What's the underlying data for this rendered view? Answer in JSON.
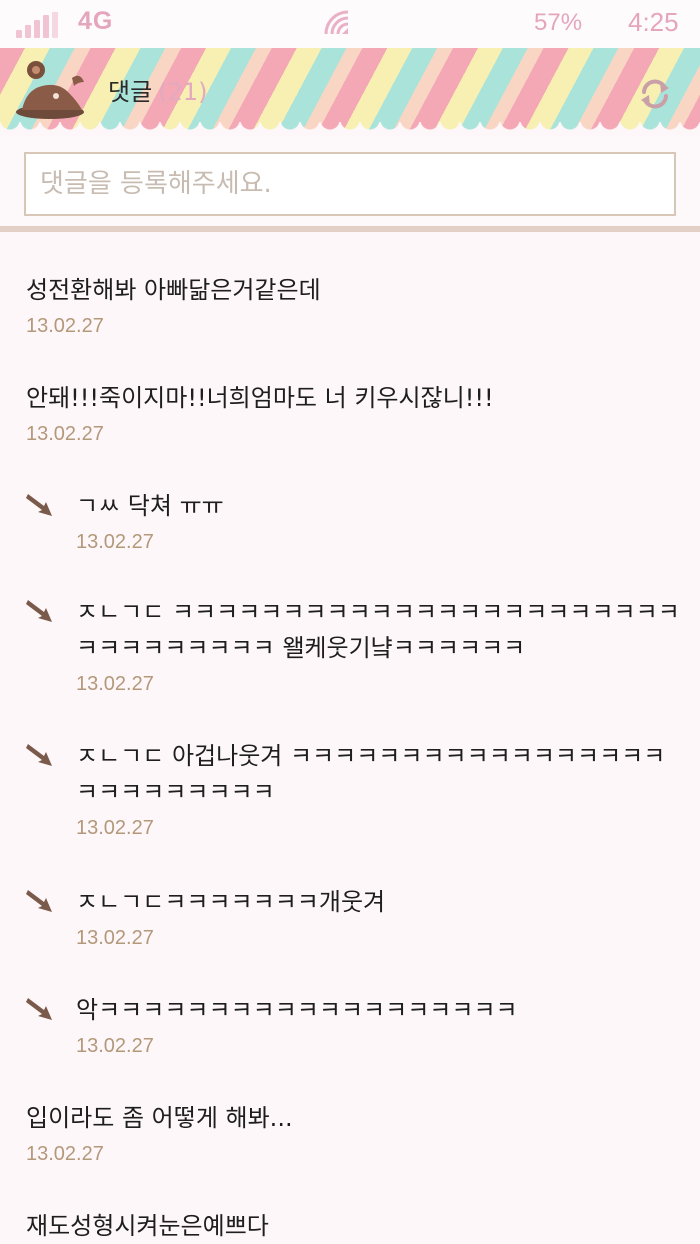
{
  "status": {
    "network": "4G",
    "battery": "57%",
    "time": "4:25"
  },
  "header": {
    "title": "댓글",
    "count": "(21)"
  },
  "input": {
    "placeholder": "댓글을 등록해주세요."
  },
  "comments": [
    {
      "text": "성전환해봐 아빠닮은거같은데",
      "date": "13.02.27",
      "reply": false
    },
    {
      "text": "안돼!!!죽이지마!!너희엄마도 너 키우시잖니!!!",
      "date": "13.02.27",
      "reply": false
    },
    {
      "text": "ㄱㅆ 닥쳐 ㅠㅠ",
      "date": "13.02.27",
      "reply": true
    },
    {
      "text": "ㅈㄴㄱㄷ ㅋㅋㅋㅋㅋㅋㅋㅋㅋㅋㅋㅋㅋㅋㅋㅋㅋㅋㅋㅋㅋㅋㅋㅋㅋㅋㅋㅋㅋㅋㅋㅋ 왤케웃기냨ㅋㅋㅋㅋㅋㅋ",
      "date": "13.02.27",
      "reply": true
    },
    {
      "text": "ㅈㄴㄱㄷ 아겁나웃겨 ㅋㅋㅋㅋㅋㅋㅋㅋㅋㅋㅋㅋㅋㅋㅋㅋㅋㅋㅋㅋㅋㅋㅋㅋㅋㅋ",
      "date": "13.02.27",
      "reply": true
    },
    {
      "text": "ㅈㄴㄱㄷㅋㅋㅋㅋㅋㅋㅋ개웃겨",
      "date": "13.02.27",
      "reply": true
    },
    {
      "text": "악ㅋㅋㅋㅋㅋㅋㅋㅋㅋㅋㅋㅋㅋㅋㅋㅋㅋㅋㅋ",
      "date": "13.02.27",
      "reply": true
    },
    {
      "text": "입이라도 좀 어떻게 해봐...",
      "date": "13.02.27",
      "reply": false
    },
    {
      "text": "재도성형시켜눈은예쁘다",
      "date": "",
      "reply": false
    }
  ]
}
